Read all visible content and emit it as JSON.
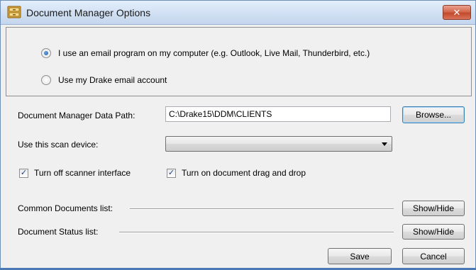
{
  "window": {
    "title": "Document Manager Options",
    "close_glyph": "✕",
    "icon": "document-manager-app-icon"
  },
  "email": {
    "option_local": "I use an email program on my computer (e.g. Outlook, Live Mail, Thunderbird, etc.)",
    "option_drake": "Use my Drake email account",
    "selected": "option_local"
  },
  "data_path": {
    "label": "Document Manager Data Path:",
    "value": "C:\\Drake15\\DDM\\CLIENTS",
    "browse_label": "Browse..."
  },
  "scan_device": {
    "label": "Use this scan device:",
    "selected_value": ""
  },
  "checkboxes": {
    "scanner_interface": {
      "label": "Turn off scanner interface",
      "checked": true
    },
    "drag_drop": {
      "label": "Turn on document drag and drop",
      "checked": true
    },
    "check_glyph": "✓"
  },
  "lists": {
    "common_label": "Common Documents list:",
    "status_label": "Document Status list:",
    "show_hide_label": "Show/Hide"
  },
  "footer": {
    "save_label": "Save",
    "cancel_label": "Cancel"
  }
}
